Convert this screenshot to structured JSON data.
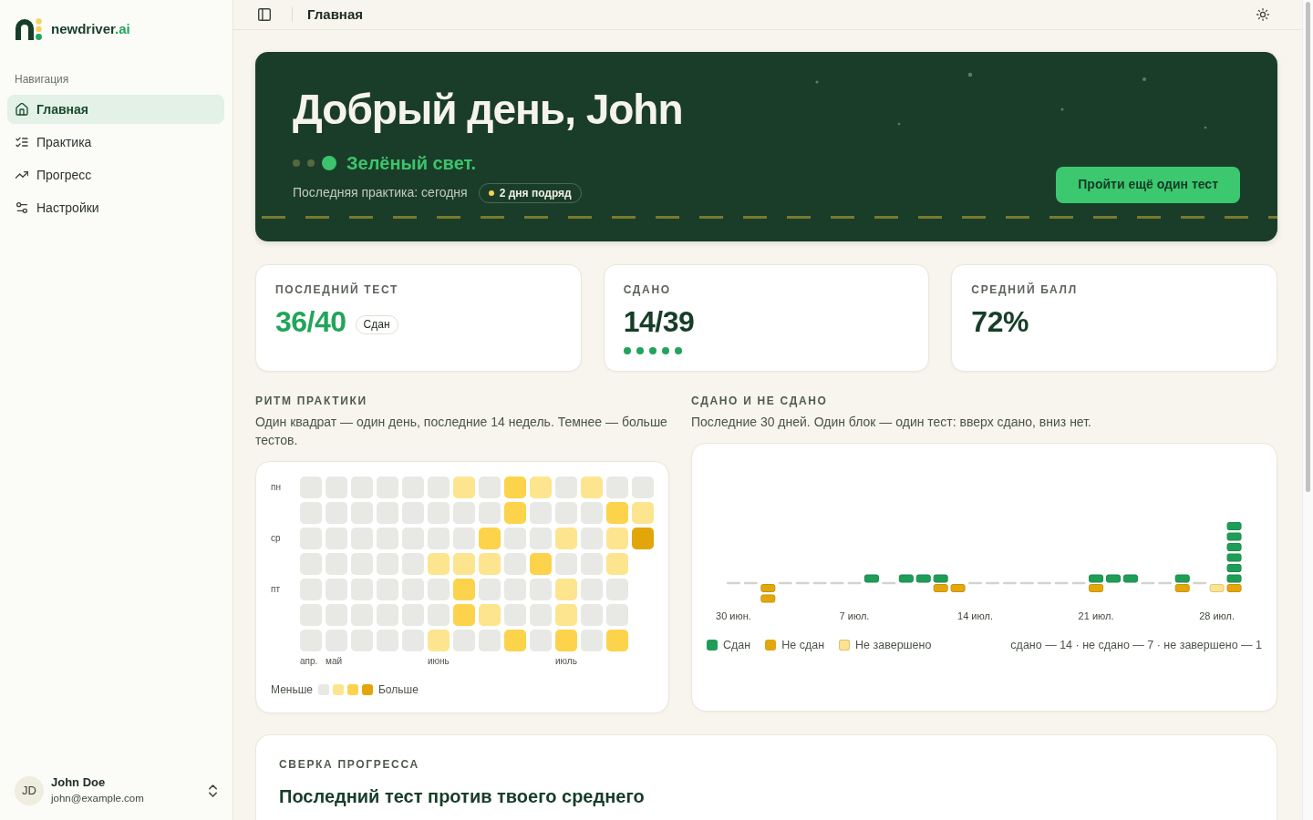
{
  "sidebar": {
    "logo": {
      "name": "newdriver",
      "suffix": ".ai"
    },
    "section_label": "Навигация",
    "items": [
      {
        "label": "Главная",
        "selected": true
      },
      {
        "label": "Практика",
        "selected": false
      },
      {
        "label": "Прогресс",
        "selected": false
      },
      {
        "label": "Настройки",
        "selected": false
      }
    ],
    "user": {
      "initials": "JD",
      "name": "John Doe",
      "email": "john@example.com"
    }
  },
  "topbar": {
    "title": "Главная"
  },
  "hero": {
    "greeting": "Добрый день, John",
    "lights": [
      {
        "on": false
      },
      {
        "on": false
      },
      {
        "on": true
      }
    ],
    "signal_label": "Зелёный свет.",
    "last_practice": "Последняя практика: сегодня",
    "streak": "2 дня подряд",
    "button": "Пройти ещё один тест"
  },
  "stats": [
    {
      "label": "ПОСЛЕДНИЙ ТЕСТ",
      "value": "36/40",
      "color": "#22a45a",
      "badge": "Сдан"
    },
    {
      "label": "СДАНО",
      "value": "14/39",
      "color": "#173d28",
      "dots": [
        {
          "filled": true
        },
        {
          "filled": true
        },
        {
          "filled": true
        },
        {
          "filled": true
        },
        {
          "filled": true
        }
      ]
    },
    {
      "label": "СРЕДНИЙ БАЛЛ",
      "value": "72%",
      "color": "#173d28"
    }
  ],
  "rhythm": {
    "title": "РИТМ ПРАКТИКИ",
    "description": "Один квадрат — один день, последние 14 недель. Темнее — больше тестов.",
    "day_labels": [
      "пн",
      "ср",
      "пт"
    ],
    "weeks": [
      {
        "month": "апр.",
        "days": [
          {
            "color": "#e8e8e5"
          },
          {
            "color": "#e8e8e5"
          },
          {
            "color": "#e8e8e5"
          },
          {
            "color": "#e8e8e5"
          },
          {
            "color": "#e8e8e5"
          },
          {
            "color": "#e8e8e5"
          },
          {
            "color": "#e8e8e5"
          }
        ]
      },
      {
        "month": "май",
        "days": [
          {
            "color": "#e8e8e5"
          },
          {
            "color": "#e8e8e5"
          },
          {
            "color": "#e8e8e5"
          },
          {
            "color": "#e8e8e5"
          },
          {
            "color": "#e8e8e5"
          },
          {
            "color": "#e8e8e5"
          },
          {
            "color": "#e8e8e5"
          }
        ]
      },
      {
        "days": [
          {
            "color": "#e8e8e5"
          },
          {
            "color": "#e8e8e5"
          },
          {
            "color": "#e8e8e5"
          },
          {
            "color": "#e8e8e5"
          },
          {
            "color": "#e8e8e5"
          },
          {
            "color": "#e8e8e5"
          },
          {
            "color": "#e8e8e5"
          }
        ]
      },
      {
        "days": [
          {
            "color": "#e8e8e5"
          },
          {
            "color": "#e8e8e5"
          },
          {
            "color": "#e8e8e5"
          },
          {
            "color": "#e8e8e5"
          },
          {
            "color": "#e8e8e5"
          },
          {
            "color": "#e8e8e5"
          },
          {
            "color": "#e8e8e5"
          }
        ]
      },
      {
        "days": [
          {
            "color": "#e8e8e5"
          },
          {
            "color": "#e8e8e5"
          },
          {
            "color": "#e8e8e5"
          },
          {
            "color": "#e8e8e5"
          },
          {
            "color": "#e8e8e5"
          },
          {
            "color": "#e8e8e5"
          },
          {
            "color": "#e8e8e5"
          }
        ]
      },
      {
        "month": "июнь",
        "days": [
          {
            "color": "#e8e8e5"
          },
          {
            "color": "#e8e8e5"
          },
          {
            "color": "#e8e8e5"
          },
          {
            "color": "#fde58f"
          },
          {
            "color": "#e8e8e5"
          },
          {
            "color": "#e8e8e5"
          },
          {
            "color": "#fde58f"
          }
        ]
      },
      {
        "days": [
          {
            "color": "#fde58f"
          },
          {
            "color": "#e8e8e5"
          },
          {
            "color": "#e8e8e5"
          },
          {
            "color": "#fde58f"
          },
          {
            "color": "#fdd34b"
          },
          {
            "color": "#fdd34b"
          },
          {
            "color": "#e8e8e5"
          }
        ]
      },
      {
        "days": [
          {
            "color": "#e8e8e5"
          },
          {
            "color": "#e8e8e5"
          },
          {
            "color": "#fdd34b"
          },
          {
            "color": "#fde58f"
          },
          {
            "color": "#e8e8e5"
          },
          {
            "color": "#fde58f"
          },
          {
            "color": "#e8e8e5"
          }
        ]
      },
      {
        "days": [
          {
            "color": "#fdd34b"
          },
          {
            "color": "#fdd34b"
          },
          {
            "color": "#e8e8e5"
          },
          {
            "color": "#e8e8e5"
          },
          {
            "color": "#e8e8e5"
          },
          {
            "color": "#e8e8e5"
          },
          {
            "color": "#fdd34b"
          }
        ]
      },
      {
        "days": [
          {
            "color": "#fde58f"
          },
          {
            "color": "#e8e8e5"
          },
          {
            "color": "#e8e8e5"
          },
          {
            "color": "#fdd34b"
          },
          {
            "color": "#e8e8e5"
          },
          {
            "color": "#e8e8e5"
          },
          {
            "color": "#e8e8e5"
          }
        ]
      },
      {
        "month": "июль",
        "days": [
          {
            "color": "#e8e8e5"
          },
          {
            "color": "#e8e8e5"
          },
          {
            "color": "#fde58f"
          },
          {
            "color": "#e8e8e5"
          },
          {
            "color": "#fde58f"
          },
          {
            "color": "#fde58f"
          },
          {
            "color": "#fdd34b"
          }
        ]
      },
      {
        "days": [
          {
            "color": "#fde58f"
          },
          {
            "color": "#e8e8e5"
          },
          {
            "color": "#e8e8e5"
          },
          {
            "color": "#e8e8e5"
          },
          {
            "color": "#e8e8e5"
          },
          {
            "color": "#e8e8e5"
          },
          {
            "color": "#e8e8e5"
          }
        ]
      },
      {
        "days": [
          {
            "color": "#e8e8e5"
          },
          {
            "color": "#fdd34b"
          },
          {
            "color": "#fde58f"
          },
          {
            "color": "#fde58f"
          },
          {
            "color": "#e8e8e5"
          },
          {
            "color": "#e8e8e5"
          },
          {
            "color": "#fdd34b"
          }
        ]
      },
      {
        "days": [
          {
            "color": "#e8e8e5"
          },
          {
            "color": "#fde58f"
          },
          {
            "color": "#e2a60a"
          }
        ]
      }
    ],
    "legend": {
      "less": "Меньше",
      "more": "Больше",
      "swatches": [
        {
          "color": "#e8e8e5"
        },
        {
          "color": "#fde58f"
        },
        {
          "color": "#fdd34b"
        },
        {
          "color": "#e2a60a"
        }
      ]
    }
  },
  "results": {
    "title": "СДАНО И НЕ СДАНО",
    "description": "Последние 30 дней. Один блок — один тест: вверх сдано, вниз нет.",
    "days": [
      {
        "kind": "rest",
        "label": "30 июн."
      },
      {
        "kind": "rest"
      },
      {
        "kind": "practice",
        "blocks": [
          {
            "kind": "failed"
          },
          {
            "kind": "failed"
          }
        ]
      },
      {
        "kind": "rest"
      },
      {
        "kind": "rest"
      },
      {
        "kind": "rest"
      },
      {
        "kind": "rest"
      },
      {
        "kind": "rest",
        "label": "7 июл."
      },
      {
        "kind": "practice",
        "blocks": [
          {
            "kind": "passed"
          }
        ]
      },
      {
        "kind": "rest"
      },
      {
        "kind": "practice",
        "blocks": [
          {
            "kind": "passed"
          }
        ]
      },
      {
        "kind": "practice",
        "blocks": [
          {
            "kind": "passed"
          }
        ]
      },
      {
        "kind": "practice",
        "blocks": [
          {
            "kind": "passed"
          },
          {
            "kind": "failed"
          }
        ]
      },
      {
        "kind": "practice",
        "blocks": [
          {
            "kind": "failed"
          }
        ]
      },
      {
        "kind": "rest",
        "label": "14 июл."
      },
      {
        "kind": "rest"
      },
      {
        "kind": "rest"
      },
      {
        "kind": "rest"
      },
      {
        "kind": "rest"
      },
      {
        "kind": "rest"
      },
      {
        "kind": "rest"
      },
      {
        "kind": "practice",
        "label": "21 июл.",
        "blocks": [
          {
            "kind": "passed"
          },
          {
            "kind": "failed"
          }
        ]
      },
      {
        "kind": "practice",
        "blocks": [
          {
            "kind": "passed"
          }
        ]
      },
      {
        "kind": "practice",
        "blocks": [
          {
            "kind": "passed"
          }
        ]
      },
      {
        "kind": "rest"
      },
      {
        "kind": "rest"
      },
      {
        "kind": "practice",
        "blocks": [
          {
            "kind": "passed"
          },
          {
            "kind": "failed"
          }
        ]
      },
      {
        "kind": "rest"
      },
      {
        "kind": "practice",
        "label": "28 июл.",
        "blocks": [
          {
            "kind": "incomplete"
          }
        ]
      },
      {
        "kind": "practice",
        "blocks": [
          {
            "kind": "passed"
          },
          {
            "kind": "passed"
          },
          {
            "kind": "passed"
          },
          {
            "kind": "passed"
          },
          {
            "kind": "passed"
          },
          {
            "kind": "passed"
          },
          {
            "kind": "failed"
          }
        ]
      }
    ],
    "legend": [
      {
        "kind": "passed",
        "label": "Сдан",
        "color": "#1f9d57"
      },
      {
        "kind": "failed",
        "label": "Не сдан",
        "color": "#e3a70c"
      },
      {
        "kind": "incomplete",
        "label": "Не завершено",
        "color": "#fde38f"
      }
    ],
    "summary": "сдано — 14 · не сдано — 7 · не завершено — 1"
  },
  "comparison": {
    "title": "СВЕРКА ПРОГРЕССА",
    "heading": "Последний тест против твоего среднего"
  }
}
